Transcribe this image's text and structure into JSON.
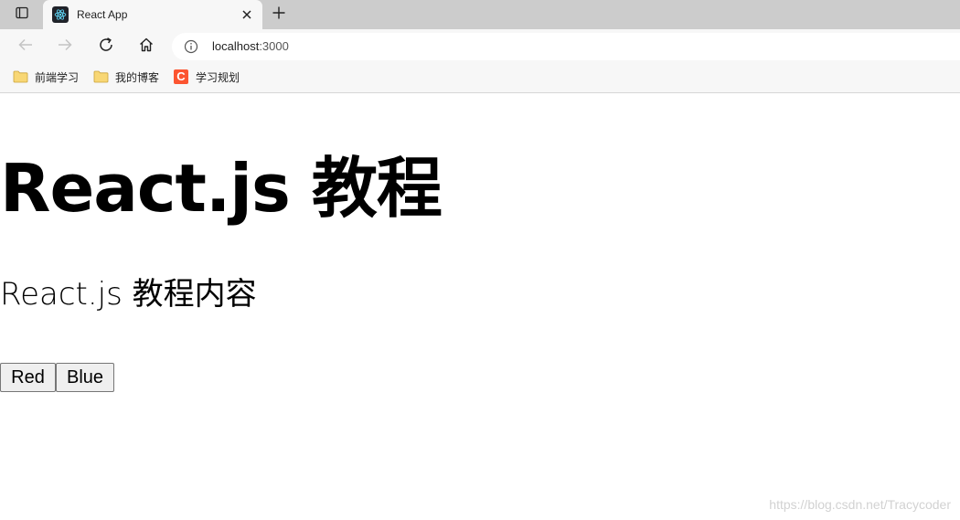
{
  "browser": {
    "tab": {
      "title": "React App"
    },
    "address": {
      "host": "localhost",
      "port": ":3000"
    },
    "bookmarks": [
      {
        "label": "前端学习",
        "icon": "folder-icon"
      },
      {
        "label": "我的博客",
        "icon": "folder-icon"
      },
      {
        "label": "学习规划",
        "icon": "csdn-logo-icon",
        "logo_letter": "C"
      }
    ]
  },
  "page": {
    "heading": "React.js 教程",
    "subheading": "React.js 教程内容",
    "buttons": {
      "red": "Red",
      "blue": "Blue"
    },
    "watermark": "https://blog.csdn.net/Tracycoder"
  },
  "colors": {
    "tabstrip": "#cccccc",
    "toolbar": "#f7f7f7",
    "csdn": "#fc5531",
    "react": "#61dafb"
  }
}
